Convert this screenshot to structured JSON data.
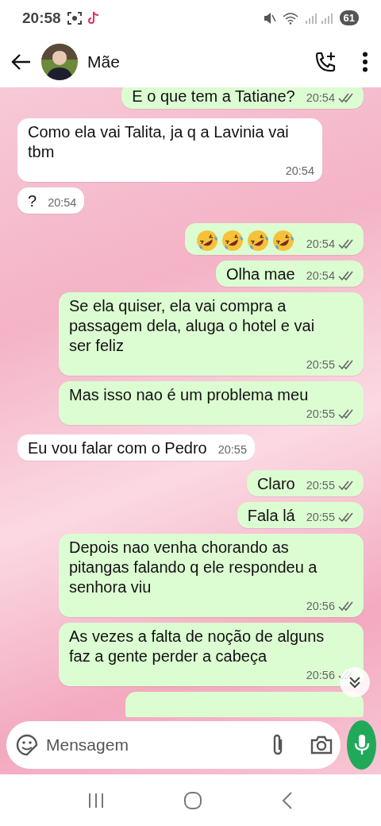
{
  "status_bar": {
    "time": "20:58",
    "battery": "61"
  },
  "header": {
    "contact_name": "Mãe"
  },
  "messages": [
    {
      "kind": "text",
      "outgoing": true,
      "text": "E o que tem a Tatiane?",
      "time": "20:54",
      "read": false
    },
    {
      "kind": "text",
      "outgoing": false,
      "text": "Como ela vai Talita, ja q a Lavinia vai tbm",
      "time": "20:54"
    },
    {
      "kind": "text",
      "outgoing": false,
      "text": "?",
      "time": "20:54"
    },
    {
      "kind": "emoji",
      "outgoing": true,
      "emojis": [
        {
          "kind": "rofl"
        },
        {
          "kind": "rofl"
        },
        {
          "kind": "rofl"
        },
        {
          "kind": "rofl"
        }
      ],
      "time": "20:54",
      "read": false
    },
    {
      "kind": "text",
      "outgoing": true,
      "text": "Olha mae",
      "time": "20:54",
      "read": false
    },
    {
      "kind": "text",
      "outgoing": true,
      "text": "Se ela quiser, ela vai compra a passagem dela, aluga o hotel e vai ser feliz",
      "time": "20:55",
      "read": false
    },
    {
      "kind": "text",
      "outgoing": true,
      "text": "Mas isso nao é um problema meu",
      "time": "20:55",
      "read": false
    },
    {
      "kind": "text",
      "outgoing": false,
      "text": "Eu vou falar com o Pedro",
      "time": "20:55"
    },
    {
      "kind": "text",
      "outgoing": true,
      "text": "Claro",
      "time": "20:55",
      "read": false
    },
    {
      "kind": "text",
      "outgoing": true,
      "text": "Fala lá",
      "time": "20:55",
      "read": false
    },
    {
      "kind": "text",
      "outgoing": true,
      "text": "Depois nao venha chorando as pitangas falando q ele respondeu a senhora viu",
      "time": "20:56",
      "read": false
    },
    {
      "kind": "text",
      "outgoing": true,
      "text": "As vezes a falta de noção de alguns faz a gente perder a cabeça",
      "time": "20:56",
      "read": false
    },
    {
      "kind": "partial",
      "outgoing": true
    }
  ],
  "composer": {
    "placeholder": "Mensagem"
  }
}
